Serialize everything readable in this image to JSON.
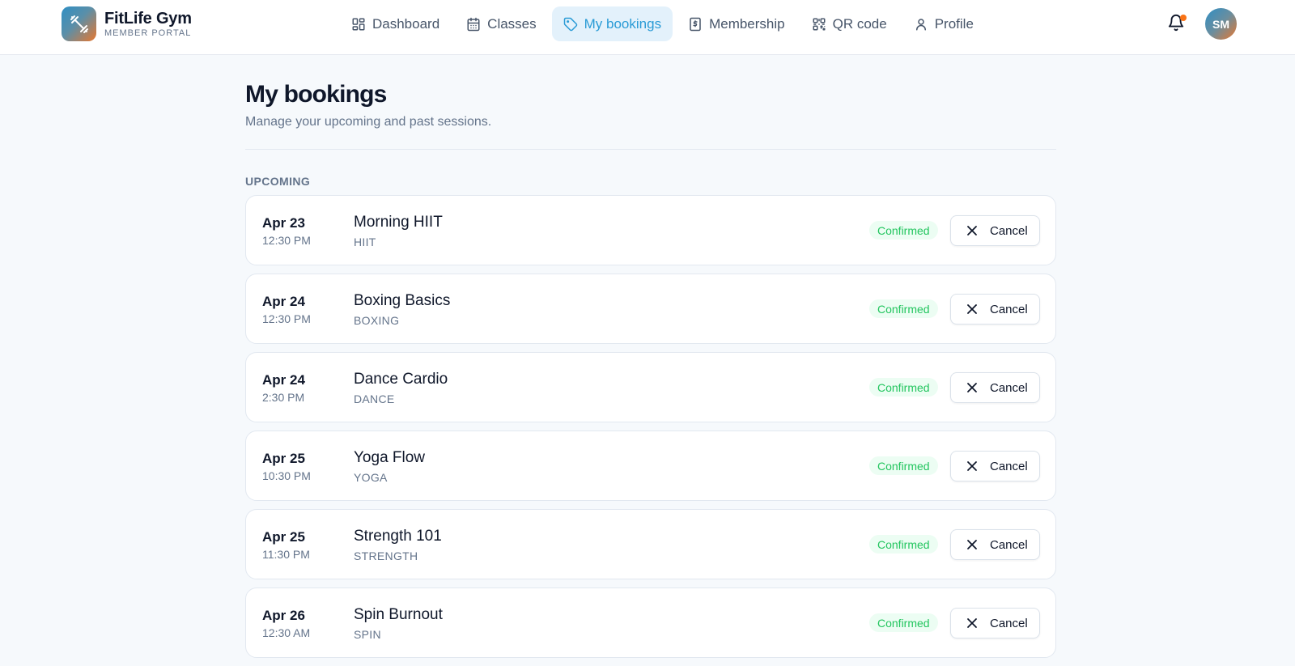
{
  "brand": {
    "name": "FitLife Gym",
    "subtitle": "MEMBER PORTAL",
    "icon": "dumbbell-icon"
  },
  "nav": [
    {
      "label": "Dashboard",
      "icon": "dashboard-icon",
      "active": false
    },
    {
      "label": "Classes",
      "icon": "calendar-icon",
      "active": false
    },
    {
      "label": "My bookings",
      "icon": "tag-icon",
      "active": true
    },
    {
      "label": "Membership",
      "icon": "receipt-icon",
      "active": false
    },
    {
      "label": "QR code",
      "icon": "qr-code-icon",
      "active": false
    },
    {
      "label": "Profile",
      "icon": "user-icon",
      "active": false
    }
  ],
  "header": {
    "avatar_initials": "SM",
    "notification_dot": true
  },
  "page": {
    "title": "My bookings",
    "subtitle": "Manage your upcoming and past sessions.",
    "section_label": "UPCOMING"
  },
  "bookings": [
    {
      "date": "Apr 23",
      "time": "12:30 PM",
      "name": "Morning HIIT",
      "category": "HIIT",
      "status": "Confirmed",
      "action": "Cancel"
    },
    {
      "date": "Apr 24",
      "time": "12:30 PM",
      "name": "Boxing Basics",
      "category": "BOXING",
      "status": "Confirmed",
      "action": "Cancel"
    },
    {
      "date": "Apr 24",
      "time": "2:30 PM",
      "name": "Dance Cardio",
      "category": "DANCE",
      "status": "Confirmed",
      "action": "Cancel"
    },
    {
      "date": "Apr 25",
      "time": "10:30 PM",
      "name": "Yoga Flow",
      "category": "YOGA",
      "status": "Confirmed",
      "action": "Cancel"
    },
    {
      "date": "Apr 25",
      "time": "11:30 PM",
      "name": "Strength 101",
      "category": "STRENGTH",
      "status": "Confirmed",
      "action": "Cancel"
    },
    {
      "date": "Apr 26",
      "time": "12:30 AM",
      "name": "Spin Burnout",
      "category": "SPIN",
      "status": "Confirmed",
      "action": "Cancel"
    }
  ],
  "colors": {
    "accent": "#2a9bd6",
    "accent_bg": "#e3f1fb",
    "confirmed": "#22c55e",
    "notification": "#f97316"
  }
}
